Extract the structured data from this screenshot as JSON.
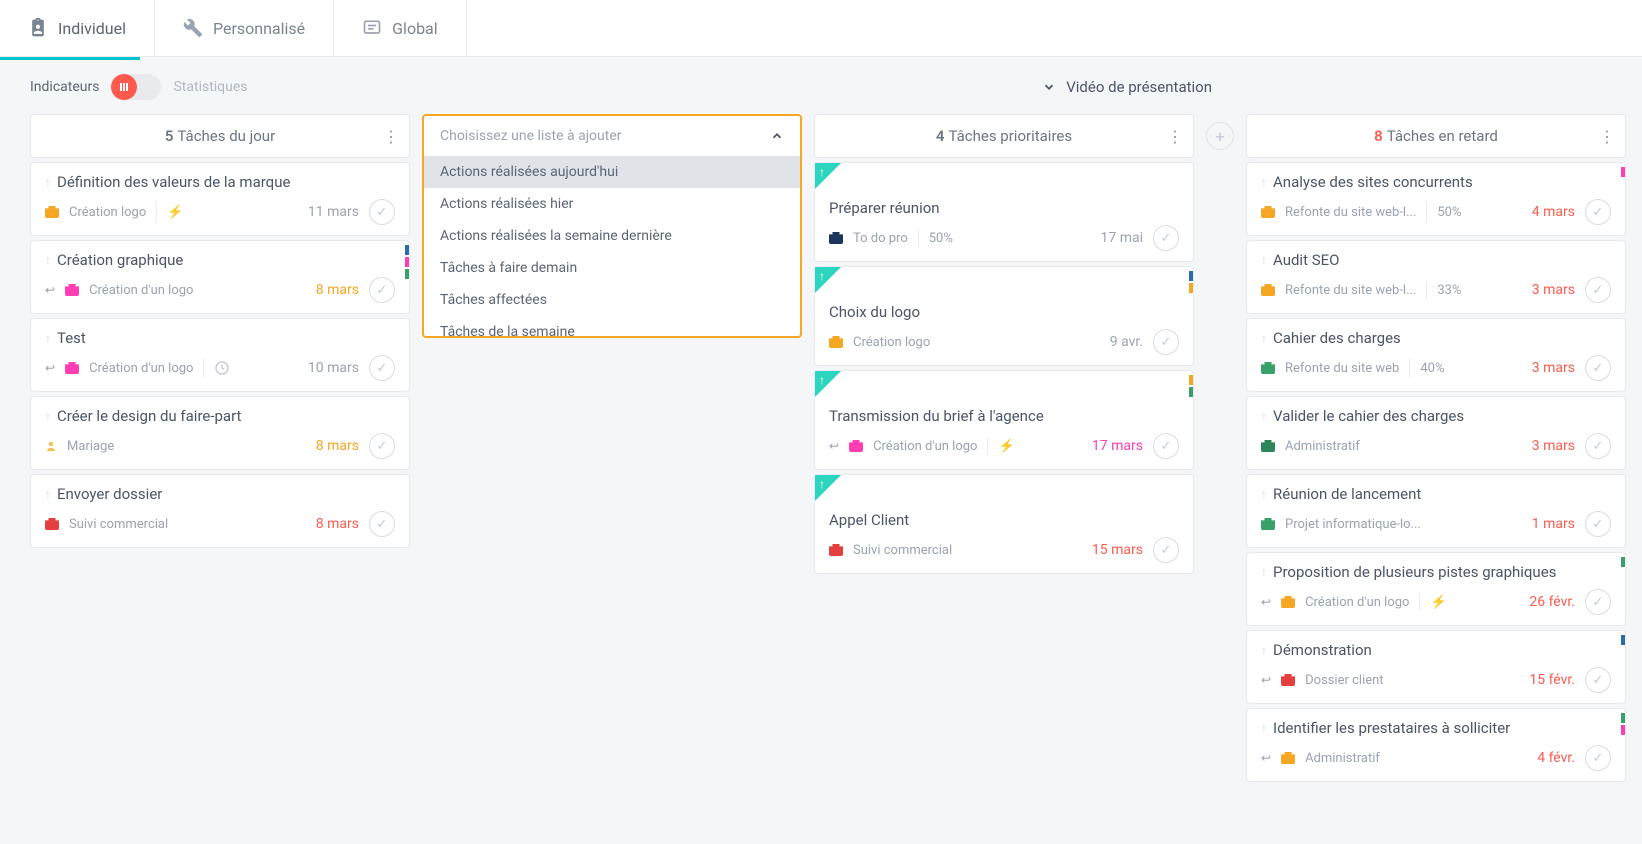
{
  "tabs": {
    "individuel": "Individuel",
    "personnalise": "Personnalisé",
    "global": "Global"
  },
  "subbar": {
    "indicateurs": "Indicateurs",
    "statistiques": "Statistiques",
    "video": "Vidéo de présentation"
  },
  "col1": {
    "count": "5",
    "title": "Tâches du jour",
    "cards": [
      {
        "title": "Définition des valeurs de la marque",
        "proj": "Création logo",
        "projColor": "#f5a623",
        "date": "11 mars",
        "dateClass": "c-gray",
        "bolt": true
      },
      {
        "title": "Création graphique",
        "proj": "Création d'un logo",
        "projColor": "#ff3db5",
        "date": "8 mars",
        "dateClass": "c-orange",
        "reply": true,
        "tags": [
          "#2b6cb0",
          "#ff3db5",
          "#38a169"
        ]
      },
      {
        "title": "Test",
        "proj": "Création d'un logo",
        "projColor": "#ff3db5",
        "date": "10 mars",
        "dateClass": "c-gray",
        "reply": true,
        "clock": true
      },
      {
        "title": "Créer le design du faire-part",
        "proj": "Mariage",
        "projColor": "#f5c14b",
        "date": "8 mars",
        "dateClass": "c-orange",
        "person": true
      },
      {
        "title": "Envoyer dossier",
        "proj": "Suivi commercial",
        "projColor": "#e53e3e",
        "date": "8 mars",
        "dateClass": "c-red"
      }
    ]
  },
  "dropdown": {
    "placeholder": "Choisissez une liste à ajouter",
    "items": [
      "Actions réalisées aujourd'hui",
      "Actions réalisées hier",
      "Actions réalisées la semaine dernière",
      "Tâches à faire demain",
      "Tâches affectées",
      "Tâches de la semaine"
    ]
  },
  "col3": {
    "count": "4",
    "title": "Tâches prioritaires",
    "cards": [
      {
        "title": "Préparer réunion",
        "proj": "To do pro",
        "projColor": "#1a365d",
        "pct": "50%",
        "date": "17 mai",
        "dateClass": "c-gray",
        "corner": true
      },
      {
        "title": "Choix du logo",
        "proj": "Création logo",
        "projColor": "#f5a623",
        "date": "9 avr.",
        "dateClass": "c-gray",
        "corner": true,
        "tags": [
          "#2b6cb0",
          "#f5a623"
        ]
      },
      {
        "title": "Transmission du brief à l'agence",
        "proj": "Création d'un logo",
        "projColor": "#ff3db5",
        "date": "17 mars",
        "dateClass": "c-pink",
        "corner": true,
        "reply": true,
        "bolt": true,
        "tags": [
          "#f5a623",
          "#38a169"
        ]
      },
      {
        "title": "Appel Client",
        "proj": "Suivi commercial",
        "projColor": "#e53e3e",
        "date": "15 mars",
        "dateClass": "c-red",
        "corner": true
      }
    ]
  },
  "col4": {
    "count": "8",
    "title": "Tâches en retard",
    "cards": [
      {
        "title": "Analyse des sites concurrents",
        "proj": "Refonte du site web-l...",
        "projColor": "#f5a623",
        "pct": "50%",
        "date": "4 mars",
        "tags": [
          "#ff3db5"
        ]
      },
      {
        "title": "Audit SEO",
        "proj": "Refonte du site web-l...",
        "projColor": "#f5a623",
        "pct": "33%",
        "date": "3 mars"
      },
      {
        "title": "Cahier des charges",
        "proj": "Refonte du site web",
        "projColor": "#38a169",
        "pct": "40%",
        "date": "3 mars"
      },
      {
        "title": "Valider le cahier des charges",
        "proj": "Administratif",
        "projColor": "#2f855a",
        "date": "3 mars"
      },
      {
        "title": "Réunion de lancement",
        "proj": "Projet informatique-lo...",
        "projColor": "#38a169",
        "date": "1 mars"
      },
      {
        "title": "Proposition de plusieurs pistes graphiques",
        "proj": "Création d'un logo",
        "projColor": "#f5a623",
        "date": "26 févr.",
        "reply": true,
        "bolt": true,
        "tags": [
          "#38a169"
        ]
      },
      {
        "title": "Démonstration",
        "proj": "Dossier client",
        "projColor": "#e53e3e",
        "date": "15 févr.",
        "reply": true,
        "tags": [
          "#2b6cb0"
        ]
      },
      {
        "title": "Identifier les prestataires à solliciter",
        "proj": "Administratif",
        "projColor": "#f5a623",
        "date": "4 févr.",
        "reply": true,
        "tags": [
          "#38a169",
          "#ff3db5"
        ]
      }
    ]
  }
}
